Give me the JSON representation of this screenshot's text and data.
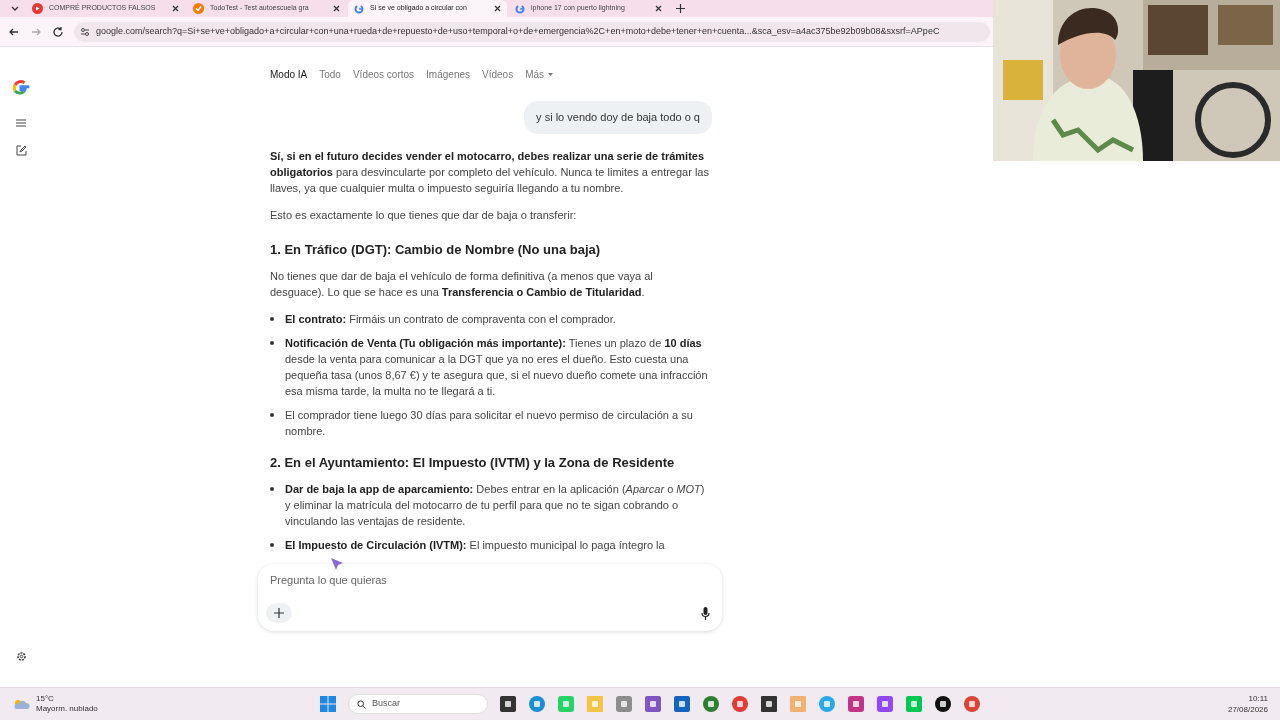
{
  "browser": {
    "tabs": [
      {
        "kind": "youtube",
        "title": "COMPRÉ PRODUCTOS FALSOS",
        "selected": false
      },
      {
        "kind": "todotest",
        "title": "TodoTest - Test autoescuela gra",
        "selected": false
      },
      {
        "kind": "google",
        "title": "Si se ve obligado a circular con",
        "selected": true
      },
      {
        "kind": "google",
        "title": "iphone 17 con puerto lightning",
        "selected": false
      }
    ],
    "url": "google.com/search?q=Si+se+ve+obligado+a+circular+con+una+rueda+de+repuesto+de+uso+temporal+o+de+emergencia%2C+en+moto+debe+tener+en+cuenta...&sca_esv=a4ac375be92b09b08&sxsrf=APpeC"
  },
  "search_tabs": [
    {
      "label": "Modo IA",
      "selected": true,
      "dropdown": false
    },
    {
      "label": "Todo",
      "selected": false,
      "dropdown": false
    },
    {
      "label": "Vídeos cortos",
      "selected": false,
      "dropdown": false
    },
    {
      "label": "Imágenes",
      "selected": false,
      "dropdown": false
    },
    {
      "label": "Vídeos",
      "selected": false,
      "dropdown": false
    },
    {
      "label": "Más",
      "selected": false,
      "dropdown": true
    }
  ],
  "user_message": "y si lo vendo doy de baja todo o q",
  "answer": [
    {
      "kind": "paragraph",
      "text": "**Sí, si en el futuro decides vender el motocarro, debes realizar una serie de trámites obligatorios** para desvincularte por completo del vehículo. Nunca te limites a entregar las llaves, ya que cualquier multa o impuesto seguiría llegando a tu nombre."
    },
    {
      "kind": "paragraph",
      "text": "Esto es exactamente lo que tienes que dar de baja o transferir:"
    },
    {
      "kind": "heading",
      "text": "1. En Tráfico (DGT): Cambio de Nombre (No una baja)"
    },
    {
      "kind": "paragraph",
      "text": "No tienes que dar de baja el vehículo de forma definitiva (a menos que vaya al desguace). Lo que se hace es una **Transferencia o Cambio de Titularidad**."
    },
    {
      "kind": "bullets",
      "items": [
        "**El contrato:** Firmáis un contrato de compraventa con el comprador.",
        "**Notificación de Venta (Tu obligación más importante):** Tienes un plazo de **10 días** desde la venta para comunicar a la DGT que ya no eres el dueño. Esto cuesta una pequeña tasa (unos 8,67 €) y te asegura que, si el nuevo dueño comete una infracción esa misma tarde, la multa no te llegará a ti.",
        "El comprador tiene luego 30 días para solicitar el nuevo permiso de circulación a su nombre."
      ]
    },
    {
      "kind": "heading",
      "text": "2. En el Ayuntamiento: El Impuesto (IVTM) y la Zona de Residente"
    },
    {
      "kind": "bullets",
      "items": [
        "**Dar de baja la app de aparcamiento:** Debes entrar en la aplicación (*Aparcar* o *MOT*) y eliminar la matrícula del motocarro de tu perfil para que no te sigan cobrando o vinculando las ventajas de residente.",
        "**El Impuesto de Circulación (IVTM):** El impuesto municipal lo paga íntegro la"
      ]
    }
  ],
  "prompt": {
    "placeholder": "Pregunta lo que quieras"
  },
  "taskbar": {
    "weather": {
      "temp": "15°C",
      "condition": "Mayorm. nublado"
    },
    "search": {
      "placeholder": "Buscar"
    },
    "time": "10:11",
    "date": "27/08/2026"
  }
}
